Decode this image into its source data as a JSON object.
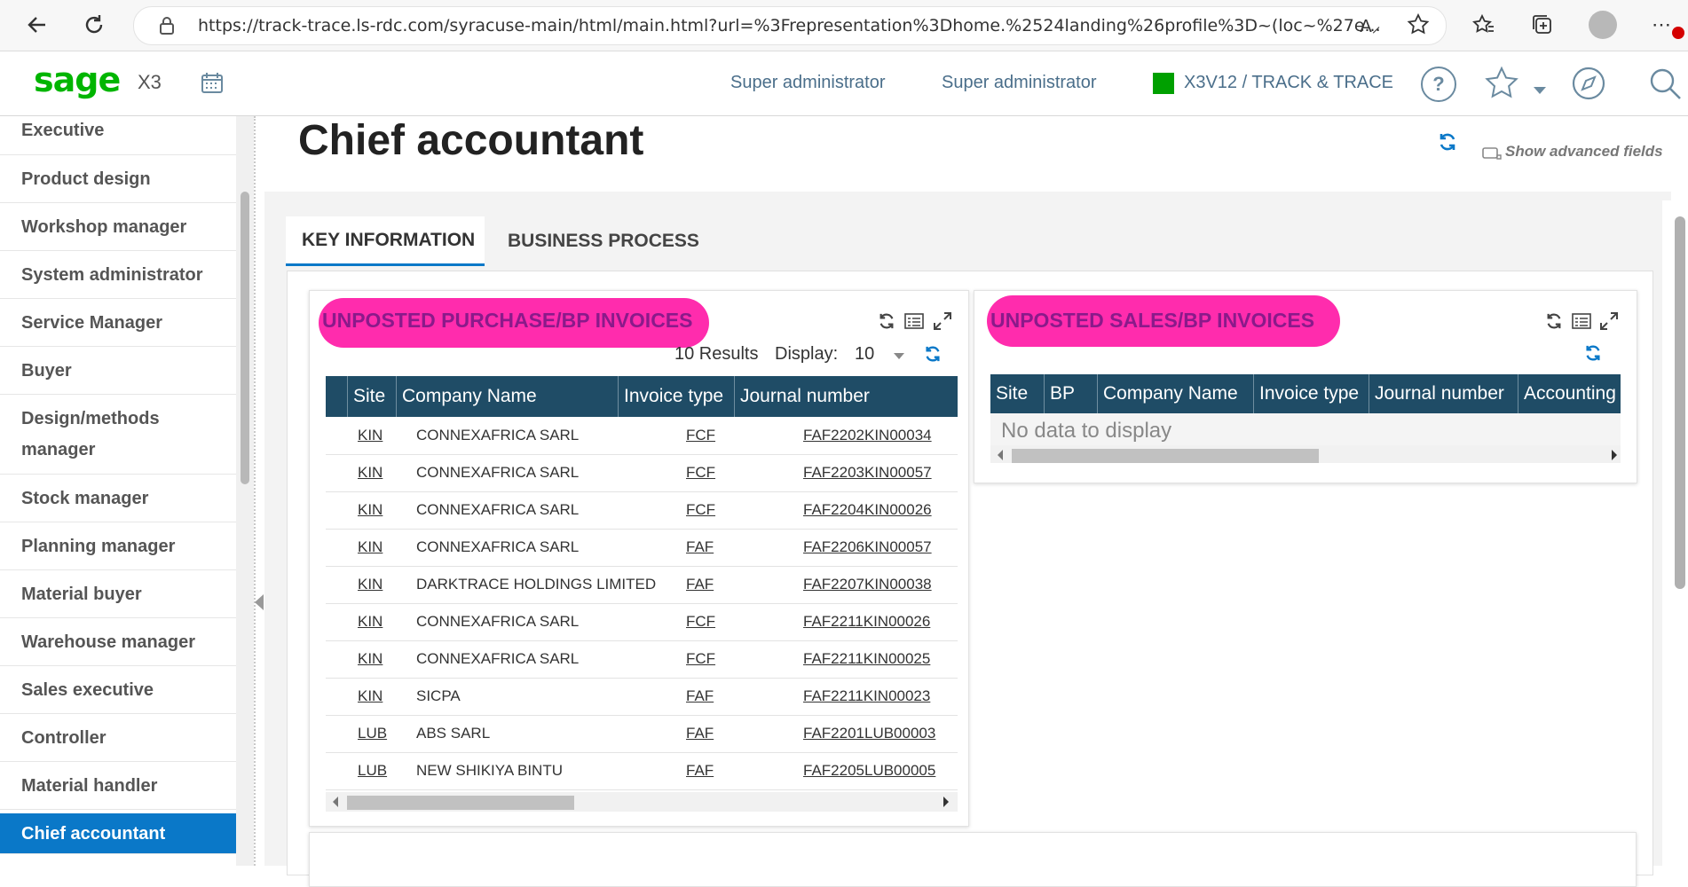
{
  "browser": {
    "url": "https://track-trace.ls-rdc.com/syracuse-main/html/main.html?url=%3Frepresentation%3Dhome.%2524landing%26profile%3D~(loc~%27e...",
    "back_icon": "back-arrow-icon",
    "reload_icon": "reload-icon"
  },
  "header": {
    "logo": "sage",
    "app": "X3",
    "user_role": "Super administrator",
    "user_name": "Super administrator",
    "endpoint": "X3V12 / TRACK & TRACE",
    "endpoint_color": "#00a000",
    "help_glyph": "?"
  },
  "sidebar": {
    "items": [
      {
        "label": "Executive"
      },
      {
        "label": "Product design"
      },
      {
        "label": "Workshop manager"
      },
      {
        "label": "System administrator"
      },
      {
        "label": "Service Manager"
      },
      {
        "label": "Buyer"
      },
      {
        "label": "Design/methods manager"
      },
      {
        "label": "Stock manager"
      },
      {
        "label": "Planning manager"
      },
      {
        "label": "Material buyer"
      },
      {
        "label": "Warehouse manager"
      },
      {
        "label": "Sales executive"
      },
      {
        "label": "Controller"
      },
      {
        "label": "Material handler"
      },
      {
        "label": "Chief accountant"
      }
    ],
    "active": "Chief accountant"
  },
  "page": {
    "title": "Chief accountant",
    "advanced_fields": "Show advanced fields",
    "tabs": [
      {
        "label": "KEY INFORMATION"
      },
      {
        "label": "BUSINESS PROCESS"
      }
    ]
  },
  "purchase": {
    "title": "UNPOSTED PURCHASE/BP INVOICES",
    "results": "10 Results",
    "display_label": "Display:",
    "display_value": "10",
    "columns": [
      "Site",
      "Company Name",
      "Invoice type",
      "Journal number"
    ],
    "rows": [
      {
        "site": "KIN",
        "company": "CONNEXAFRICA SARL",
        "type": "FCF",
        "journal": "FAF2202KIN00034"
      },
      {
        "site": "KIN",
        "company": "CONNEXAFRICA SARL",
        "type": "FCF",
        "journal": "FAF2203KIN00057"
      },
      {
        "site": "KIN",
        "company": "CONNEXAFRICA SARL",
        "type": "FCF",
        "journal": "FAF2204KIN00026"
      },
      {
        "site": "KIN",
        "company": "CONNEXAFRICA SARL",
        "type": "FAF",
        "journal": "FAF2206KIN00057"
      },
      {
        "site": "KIN",
        "company": "DARKTRACE HOLDINGS LIMITED",
        "type": "FAF",
        "journal": "FAF2207KIN00038"
      },
      {
        "site": "KIN",
        "company": "CONNEXAFRICA SARL",
        "type": "FCF",
        "journal": "FAF2211KIN00026"
      },
      {
        "site": "KIN",
        "company": "CONNEXAFRICA SARL",
        "type": "FCF",
        "journal": "FAF2211KIN00025"
      },
      {
        "site": "KIN",
        "company": "SICPA",
        "type": "FAF",
        "journal": "FAF2211KIN00023"
      },
      {
        "site": "LUB",
        "company": "ABS SARL",
        "type": "FAF",
        "journal": "FAF2201LUB00003"
      },
      {
        "site": "LUB",
        "company": "NEW SHIKIYA BINTU",
        "type": "FAF",
        "journal": "FAF2205LUB00005"
      }
    ]
  },
  "sales": {
    "title": "UNPOSTED SALES/BP INVOICES",
    "columns": [
      "Site",
      "BP",
      "Company Name",
      "Invoice type",
      "Journal number",
      "Accounting"
    ],
    "empty": "No data to display"
  }
}
